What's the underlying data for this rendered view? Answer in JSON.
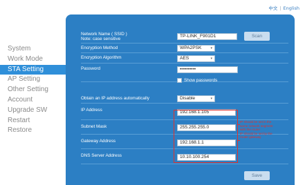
{
  "language": {
    "chinese": "中文",
    "separator": "|",
    "english": "English"
  },
  "menu": [
    {
      "label": "System",
      "active": false
    },
    {
      "label": "Work Mode",
      "active": false
    },
    {
      "label": "STA Setting",
      "active": true
    },
    {
      "label": "AP Setting",
      "active": false
    },
    {
      "label": "Other Setting",
      "active": false
    },
    {
      "label": "Account",
      "active": false
    },
    {
      "label": "Upgrade SW",
      "active": false
    },
    {
      "label": "Restart",
      "active": false
    },
    {
      "label": "Restore",
      "active": false
    }
  ],
  "form": {
    "network_name_label": "Network Name ( SSID )",
    "network_name_note": "Note: case sensitive",
    "network_name_value": "TP-LINK_F901D1",
    "scan_label": "Scan",
    "encryption_method_label": "Encryption Method",
    "encryption_method_value": "WPA2PSK",
    "encryption_algorithm_label": "Encryption Algorithm",
    "encryption_algorithm_value": "AES",
    "password_label": "Password",
    "password_value": "••••••••••",
    "show_passwords_label": "Show passwords",
    "obtain_ip_label": "Obtain an IP address automatically",
    "obtain_ip_value": "Disable",
    "ip_address_label": "IP Address",
    "ip_address_value": "192.168.1.105",
    "subnet_mask_label": "Subnet Mask",
    "subnet_mask_value": "255.255.255.0",
    "gateway_label": "Gateway Address",
    "gateway_value": "192.168.1.1",
    "dns_label": "DNS Server Address",
    "dns_value": "10.10.100.254",
    "save_label": "Save"
  },
  "annotation": {
    "line1": "IP should be set in the",
    "line2": "same network segment",
    "line3": "with the router",
    "line4": "IP should be set by the",
    "line5": "router gateway"
  },
  "colors": {
    "panel": "#2c7fc4",
    "active_menu": "#2f8fd9",
    "annotation": "#e0322d"
  }
}
